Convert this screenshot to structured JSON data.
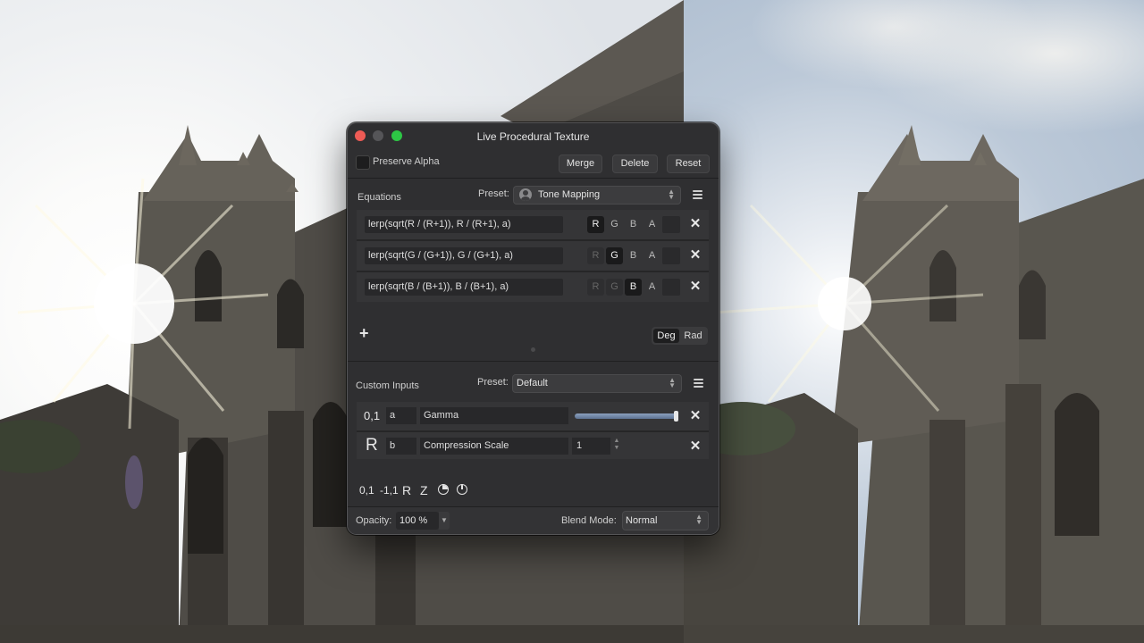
{
  "window": {
    "title": "Live Procedural Texture"
  },
  "top_bar": {
    "preserve_alpha_label": "Preserve Alpha",
    "preserve_alpha_checked": false,
    "merge_label": "Merge",
    "delete_label": "Delete",
    "reset_label": "Reset"
  },
  "equations": {
    "section_label": "Equations",
    "preset_label": "Preset:",
    "preset_value": "Tone Mapping",
    "preset_icon": "user-icon",
    "rows": [
      {
        "expr": "lerp(sqrt(R / (R+1)), R / (R+1), a)",
        "channels": [
          "R",
          "G",
          "B",
          "A"
        ],
        "active": "R"
      },
      {
        "expr": "lerp(sqrt(G / (G+1)), G / (G+1), a)",
        "channels": [
          "R",
          "G",
          "B",
          "A"
        ],
        "active": "G"
      },
      {
        "expr": "lerp(sqrt(B / (B+1)), B / (B+1), a)",
        "channels": [
          "R",
          "G",
          "B",
          "A"
        ],
        "active": "B"
      }
    ],
    "add_label": "+",
    "angle_units": [
      "Deg",
      "Rad"
    ],
    "angle_selected": "Deg"
  },
  "custom_inputs": {
    "section_label": "Custom Inputs",
    "preset_label": "Preset:",
    "preset_value": "Default",
    "rows": [
      {
        "type_label": "0,1",
        "var": "a",
        "name": "Gamma",
        "slider_value": 1.0
      },
      {
        "type_label": "R",
        "var": "b",
        "name": "Compression Scale",
        "value": "1"
      }
    ],
    "add_types": [
      "0,1",
      "-1,1",
      "R",
      "Z"
    ]
  },
  "footer": {
    "opacity_label": "Opacity:",
    "opacity_value": "100 %",
    "blend_label": "Blend Mode:",
    "blend_value": "Normal"
  },
  "colors": {
    "close": "#ee5b55",
    "minimize": "#555558",
    "maximize": "#2dc745",
    "panel_bg": "#2f2f31",
    "slider_fill": "#7589a8"
  }
}
